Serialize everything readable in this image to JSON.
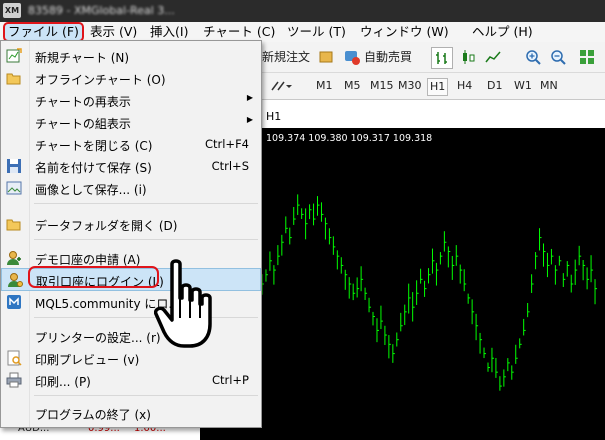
{
  "window": {
    "title": "83589 - XMGlobal-Real 3..."
  },
  "menubar": {
    "file": "ファイル (F)",
    "view": "表示 (V)",
    "insert": "挿入(I)",
    "chart": "チャート (C)",
    "tools": "ツール (T)",
    "window": "ウィンドウ (W)",
    "help": "ヘルプ (H)"
  },
  "toolbar": {
    "new_order": "新規注文",
    "auto_trading": "自動売買"
  },
  "timeframes": [
    "M1",
    "M5",
    "M15",
    "M30",
    "H1",
    "H4",
    "D1",
    "W1",
    "MN"
  ],
  "active_timeframe": "H1",
  "chart": {
    "tab_label": "H1",
    "ohlc": "109.374 109.380 109.317 109.318",
    "line_color": "#00ff00",
    "background": "#000000",
    "values": [
      109.3,
      109.32,
      109.35,
      109.33,
      109.36,
      109.39,
      109.42,
      109.4,
      109.44,
      109.47,
      109.45,
      109.43,
      109.46,
      109.44,
      109.47,
      109.45,
      109.43,
      109.4,
      109.38,
      109.36,
      109.34,
      109.32,
      109.3,
      109.28,
      109.29,
      109.31,
      109.28,
      109.25,
      109.23,
      109.2,
      109.22,
      109.19,
      109.17,
      109.15,
      109.18,
      109.21,
      109.24,
      109.27,
      109.25,
      109.28,
      109.31,
      109.29,
      109.32,
      109.35,
      109.33,
      109.36,
      109.39,
      109.37,
      109.34,
      109.36,
      109.33,
      109.3,
      109.27,
      109.24,
      109.21,
      109.18,
      109.15,
      109.12,
      109.14,
      109.11,
      109.08,
      109.1,
      109.13,
      109.11,
      109.14,
      109.17,
      109.2,
      109.24,
      109.3,
      109.36,
      109.4,
      109.37,
      109.34,
      109.36,
      109.33,
      109.35,
      109.31,
      109.34,
      109.3,
      109.33,
      109.36,
      109.34,
      109.31,
      109.33,
      109.29
    ]
  },
  "left_panel": {
    "row_symbol": "AUD...",
    "row_bid": "0.99...",
    "row_ask": "1.00..."
  },
  "file_menu": {
    "items": [
      {
        "label": "新規チャート (N)",
        "icon": "new-chart-icon"
      },
      {
        "label": "オフラインチャート (O)",
        "icon": "offline-chart-icon"
      },
      {
        "label": "チャートの再表示",
        "submenu": true
      },
      {
        "label": "チャートの組表示",
        "submenu": true
      },
      {
        "label": "チャートを閉じる (C)",
        "shortcut": "Ctrl+F4"
      },
      {
        "label": "名前を付けて保存 (S)",
        "shortcut": "Ctrl+S",
        "icon": "save-icon"
      },
      {
        "label": "画像として保存... (i)",
        "icon": "save-image-icon"
      },
      {
        "label": "データフォルダを開く (D)",
        "icon": "folder-icon"
      },
      {
        "label": "デモ口座の申請 (A)",
        "icon": "demo-account-icon"
      },
      {
        "label": "取引口座にログイン (L)",
        "icon": "login-icon"
      },
      {
        "label": "MQL5.community にロ...",
        "icon": "mql5-icon"
      },
      {
        "label": "プリンターの設定... (r)"
      },
      {
        "label": "印刷プレビュー (v)",
        "icon": "print-preview-icon"
      },
      {
        "label": "印刷... (P)",
        "shortcut": "Ctrl+P",
        "icon": "print-icon"
      },
      {
        "label": "プログラムの終了 (x)"
      }
    ],
    "highlighted_index": 9
  },
  "colors": {
    "callout": "#e0141a",
    "hover": "#cce4f7",
    "chart_line": "#00ff00"
  }
}
